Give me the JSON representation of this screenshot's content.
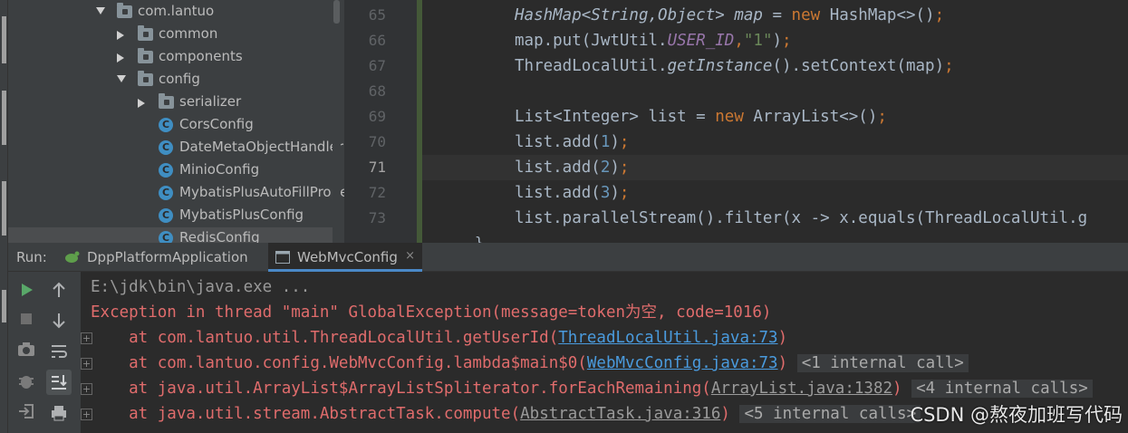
{
  "tree": {
    "items": [
      {
        "label": "com.lantuo",
        "kind": "package",
        "arrow": "down"
      },
      {
        "label": "common",
        "kind": "package",
        "arrow": "right"
      },
      {
        "label": "components",
        "kind": "package",
        "arrow": "right"
      },
      {
        "label": "config",
        "kind": "package",
        "arrow": "down"
      },
      {
        "label": "serializer",
        "kind": "package",
        "arrow": "right"
      },
      {
        "label": "CorsConfig",
        "kind": "class"
      },
      {
        "label": "DateMetaObjectHandler",
        "kind": "class"
      },
      {
        "label": "MinioConfig",
        "kind": "class"
      },
      {
        "label": "MybatisPlusAutoFillProperties",
        "kind": "class"
      },
      {
        "label": "MybatisPlusConfig",
        "kind": "class"
      },
      {
        "label": "RedisConfig",
        "kind": "class"
      }
    ],
    "class_icon_letter": "C"
  },
  "editor": {
    "line_numbers": [
      "65",
      "66",
      "67",
      "68",
      "69",
      "70",
      "71",
      "72",
      "73"
    ],
    "current_line": "71",
    "tail": "}"
  },
  "run": {
    "label": "Run:",
    "tabs": [
      {
        "label": "DppPlatformApplication",
        "active": false
      },
      {
        "label": "WebMvcConfig",
        "active": true,
        "close": "×"
      }
    ],
    "toolbar_icons": [
      "run-icon",
      "stop-icon",
      "camera-icon",
      "bug-icon",
      "login-icon",
      "scroll-up-icon",
      "scroll-down-icon",
      "soft-wrap-icon",
      "scroll-to-end-icon",
      "print-icon"
    ]
  },
  "console": {
    "cmd": "E:\\jdk\\bin\\java.exe ...",
    "exception": "Exception in thread \"main\" GlobalException(message=token为空, code=1016)",
    "frames": [
      {
        "prefix": "\tat com.lantuo.util.ThreadLocalUtil.getUserId(",
        "link": "ThreadLocalUtil.java:73",
        "suffix": ")",
        "chip": ""
      },
      {
        "prefix": "\tat com.lantuo.config.WebMvcConfig.lambda$main$0(",
        "link": "WebMvcConfig.java:73",
        "suffix": ")",
        "chip": "<1 internal call>"
      },
      {
        "prefix": "\tat java.util.ArrayList$ArrayListSpliterator.forEachRemaining(",
        "link": "ArrayList.java:1382",
        "suffix": ")",
        "chip": "<4 internal calls>"
      },
      {
        "prefix": "\tat java.util.stream.AbstractTask.compute(",
        "link": "AbstractTask.java:316",
        "suffix": ")",
        "chip": "<5 internal calls>"
      }
    ]
  },
  "watermark": "CSDN @熬夜加班写代码",
  "colors": {
    "keyword": "#cc7832",
    "string": "#6a8759",
    "number": "#6897bb",
    "static_field": "#9876aa",
    "error": "#e06c6c",
    "link": "#4a9bde"
  }
}
